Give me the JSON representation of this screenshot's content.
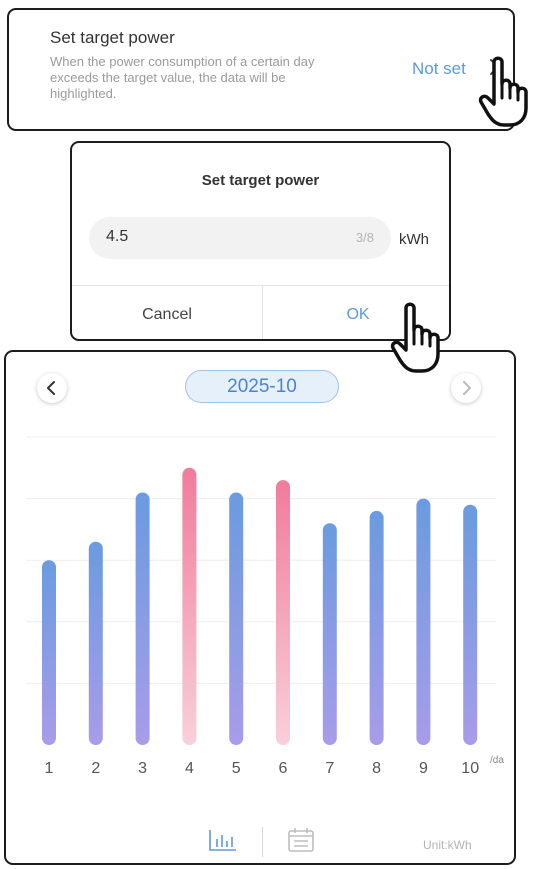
{
  "target_row": {
    "title": "Set target power",
    "description": "When the power consumption of a certain day exceeds the target value, the data will be highlighted.",
    "value": "Not set"
  },
  "dialog": {
    "title": "Set target power",
    "input_value": "4.5",
    "char_count": "3/8",
    "unit": "kWh",
    "cancel_label": "Cancel",
    "ok_label": "OK"
  },
  "chart_panel": {
    "month": "2025-10",
    "unit_label": "Unit:kWh",
    "x_unit": "/da"
  },
  "colors": {
    "accent": "#5a9ae0",
    "normal_bar_top": "#6a9be0",
    "normal_bar_bottom": "#a89ce9",
    "highlight_bar_top": "#f17b9c",
    "highlight_bar_bottom": "#f8d0da"
  },
  "icons": [
    "chevron-right-icon",
    "chevron-left-icon",
    "bar-chart-icon",
    "calendar-icon",
    "hand-pointer-icon"
  ],
  "chart_data": {
    "type": "bar",
    "categories": [
      "1",
      "2",
      "3",
      "4",
      "5",
      "6",
      "7",
      "8",
      "9",
      "10"
    ],
    "values": [
      3.0,
      3.3,
      4.1,
      4.5,
      4.1,
      4.3,
      3.6,
      3.8,
      4.0,
      3.9
    ],
    "highlighted": [
      false,
      false,
      false,
      true,
      false,
      true,
      false,
      false,
      false,
      false
    ],
    "xlabel": "/da",
    "ylabel": "",
    "ylim": [
      0,
      5
    ],
    "grid": true,
    "unit": "kWh"
  }
}
